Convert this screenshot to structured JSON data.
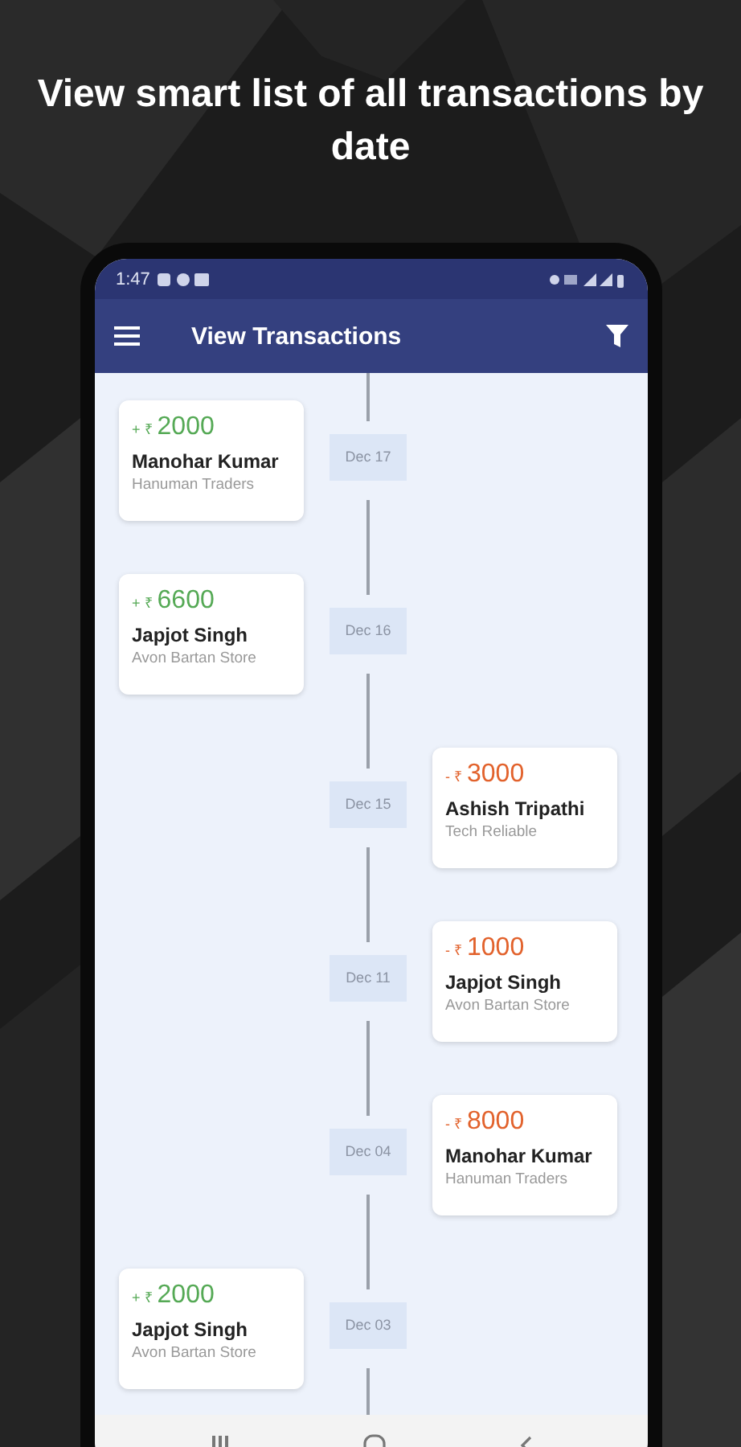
{
  "headline": "View smart list of all transactions by date",
  "status_bar": {
    "time": "1:47"
  },
  "app_bar": {
    "title": "View Transactions"
  },
  "transactions": [
    {
      "kind": "credit",
      "sign": "+ ₹",
      "amount": "2000",
      "name": "Manohar Kumar",
      "shop": "Hanuman Traders",
      "date": "Dec 17"
    },
    {
      "kind": "credit",
      "sign": "+ ₹",
      "amount": "6600",
      "name": "Japjot Singh",
      "shop": "Avon Bartan Store",
      "date": "Dec 16"
    },
    {
      "kind": "debit",
      "sign": "- ₹",
      "amount": "3000",
      "name": "Ashish Tripathi",
      "shop": "Tech Reliable",
      "date": "Dec 15"
    },
    {
      "kind": "debit",
      "sign": "- ₹",
      "amount": "1000",
      "name": "Japjot Singh",
      "shop": "Avon Bartan Store",
      "date": "Dec 11"
    },
    {
      "kind": "debit",
      "sign": "- ₹",
      "amount": "8000",
      "name": "Manohar Kumar",
      "shop": "Hanuman Traders",
      "date": "Dec 04"
    },
    {
      "kind": "credit",
      "sign": "+ ₹",
      "amount": "2000",
      "name": "Japjot Singh",
      "shop": "Avon Bartan Store",
      "date": "Dec 03"
    }
  ]
}
